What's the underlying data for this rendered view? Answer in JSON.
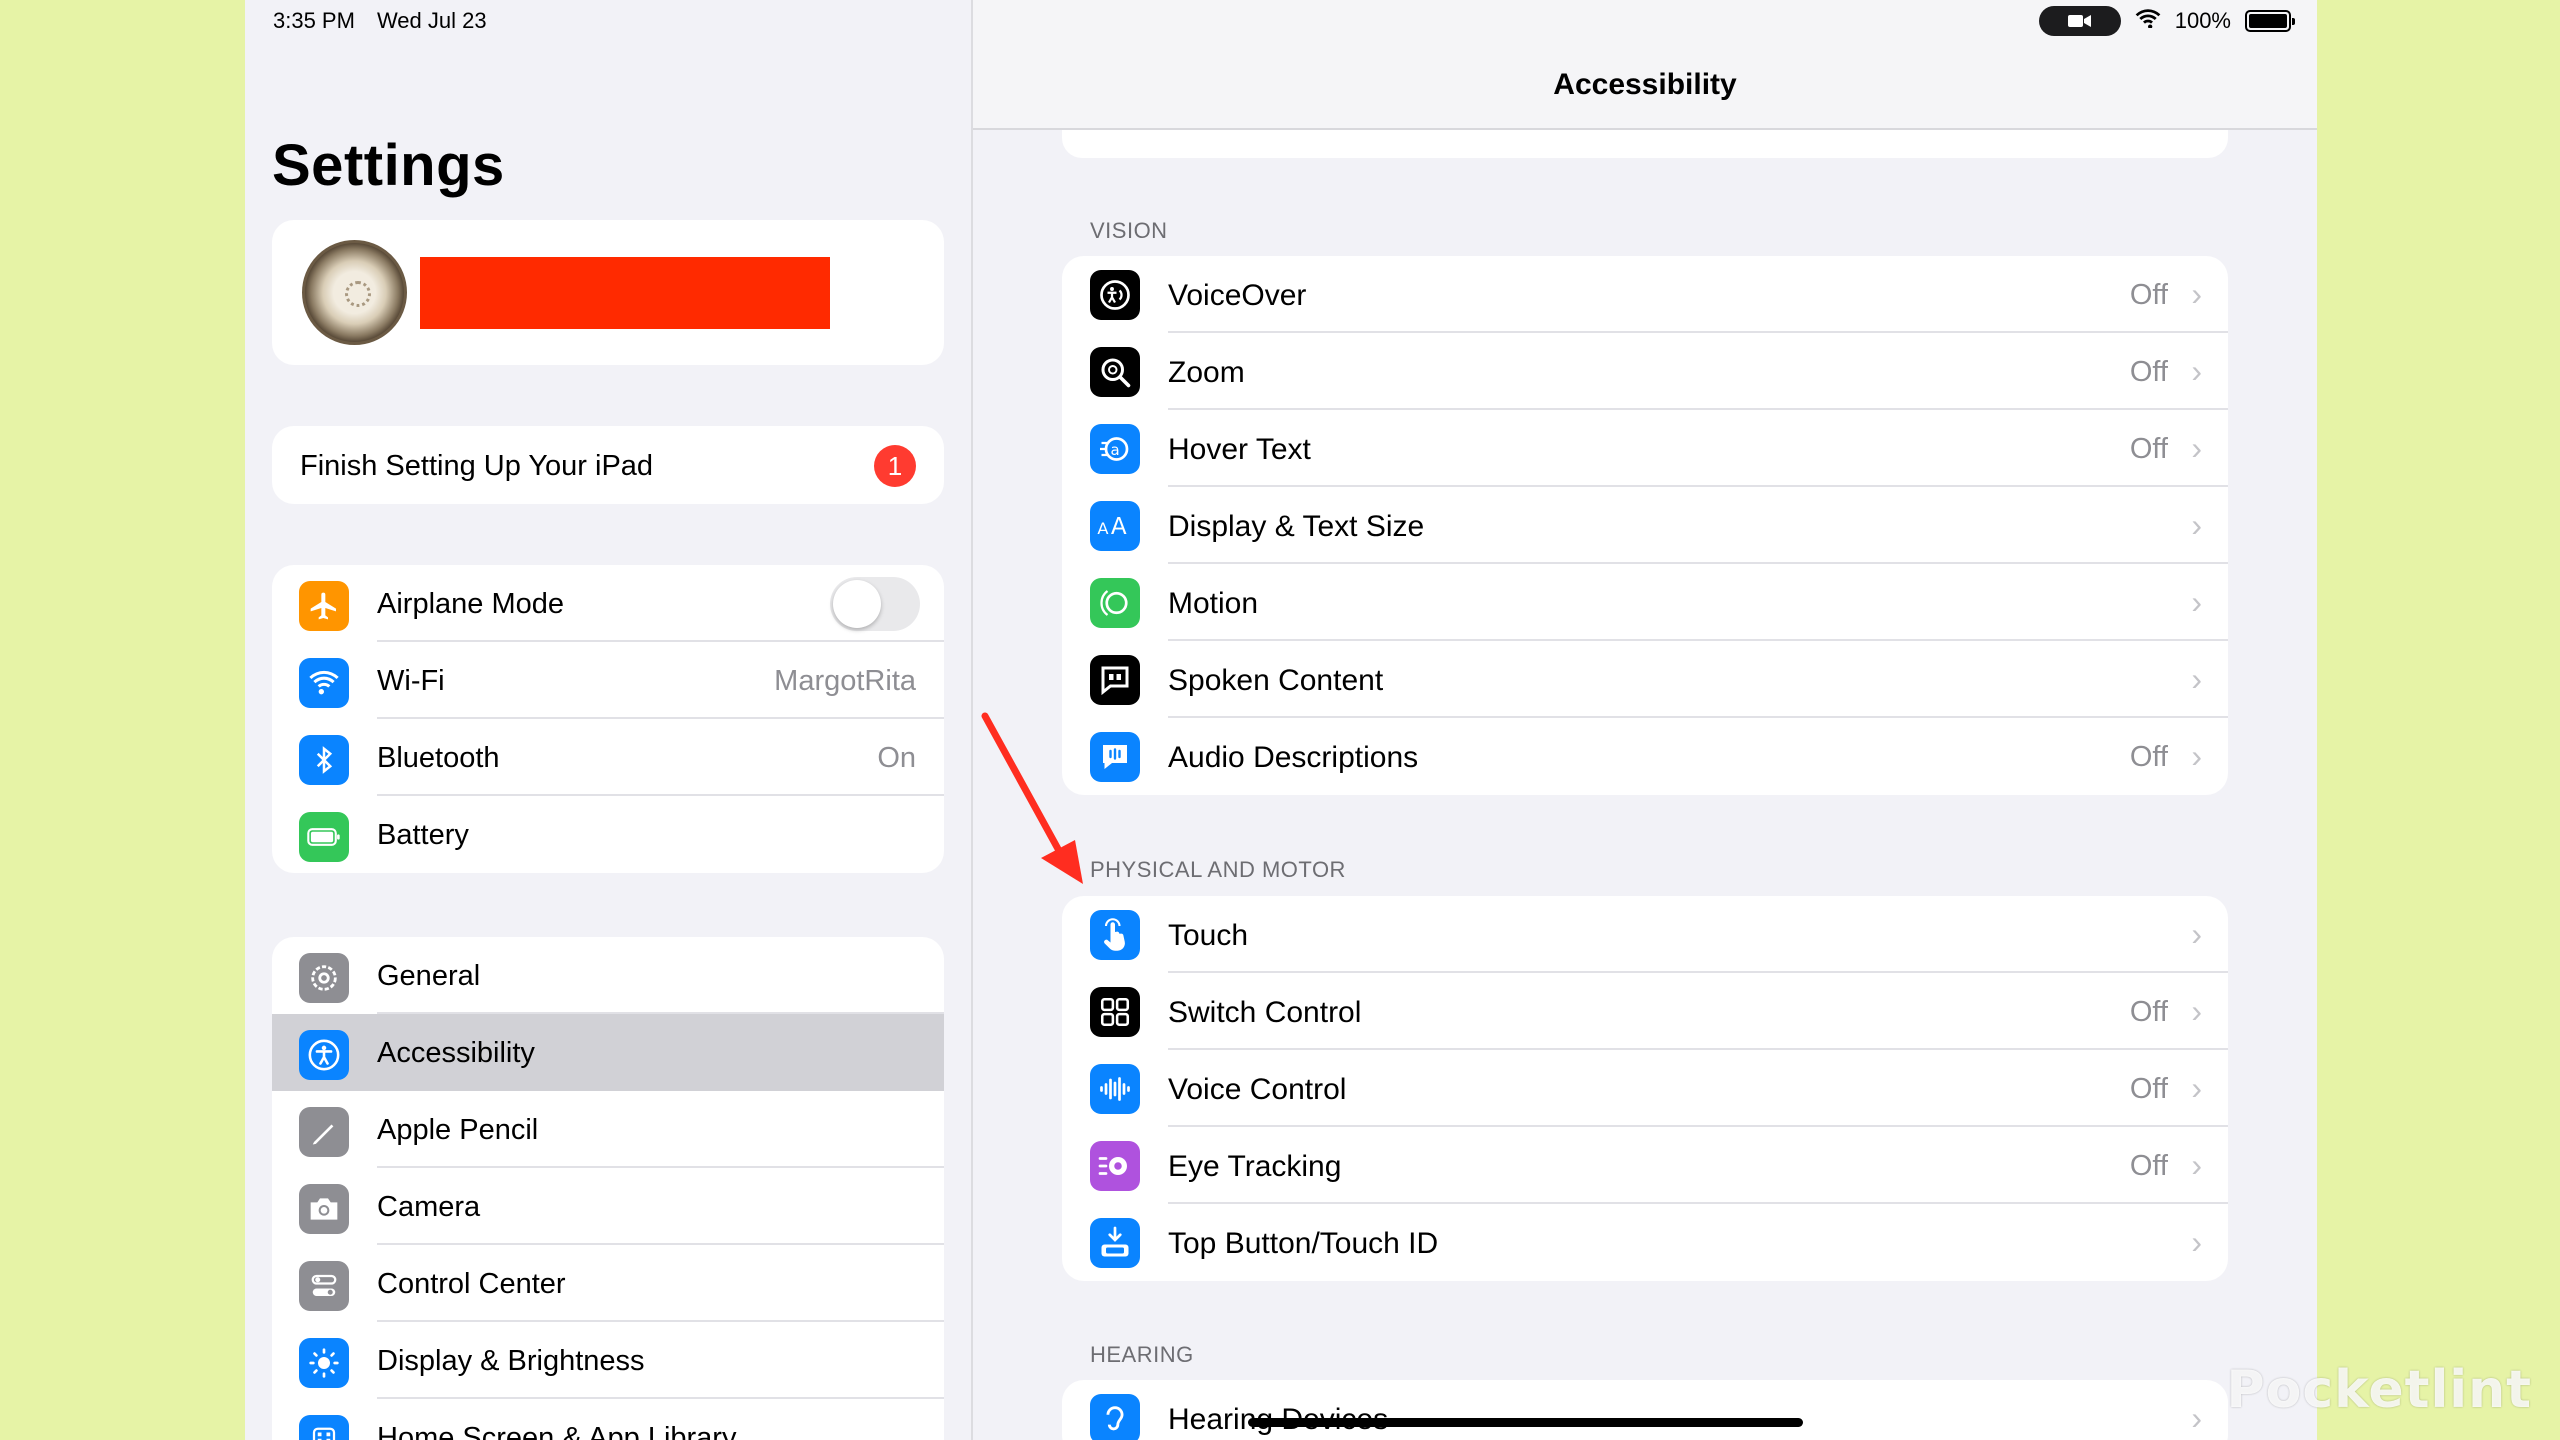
{
  "status_bar": {
    "time": "3:35 PM",
    "date": "Wed Jul 23",
    "battery": "100%"
  },
  "sidebar": {
    "title": "Settings",
    "finish_setup": {
      "label": "Finish Setting Up Your iPad",
      "badge": "1"
    },
    "connectivity": [
      {
        "label": "Airplane Mode",
        "icon": "airplane-icon",
        "color": "#ff9500",
        "toggle": false
      },
      {
        "label": "Wi-Fi",
        "icon": "wifi-icon",
        "color": "#0a84ff",
        "value": "MargotRita"
      },
      {
        "label": "Bluetooth",
        "icon": "bluetooth-icon",
        "color": "#0a84ff",
        "value": "On"
      },
      {
        "label": "Battery",
        "icon": "battery-icon",
        "color": "#34c759"
      }
    ],
    "general": [
      {
        "label": "General",
        "icon": "gear-icon",
        "color": "#8e8e93"
      },
      {
        "label": "Accessibility",
        "icon": "accessibility-icon",
        "color": "#0a84ff",
        "selected": true
      },
      {
        "label": "Apple Pencil",
        "icon": "pencil-icon",
        "color": "#8e8e93"
      },
      {
        "label": "Camera",
        "icon": "camera-icon",
        "color": "#8e8e93"
      },
      {
        "label": "Control Center",
        "icon": "control-center-icon",
        "color": "#8e8e93"
      },
      {
        "label": "Display & Brightness",
        "icon": "sun-icon",
        "color": "#0a84ff"
      },
      {
        "label": "Home Screen & App Library",
        "icon": "home-screen-icon",
        "color": "#0a84ff"
      }
    ]
  },
  "detail": {
    "title": "Accessibility",
    "vision": {
      "header": "VISION",
      "rows": [
        {
          "label": "VoiceOver",
          "value": "Off",
          "icon": "voiceover-icon",
          "color": "#000000"
        },
        {
          "label": "Zoom",
          "value": "Off",
          "icon": "zoom-icon",
          "color": "#000000"
        },
        {
          "label": "Hover Text",
          "value": "Off",
          "icon": "hover-text-icon",
          "color": "#0a84ff"
        },
        {
          "label": "Display & Text Size",
          "value": "",
          "icon": "text-size-icon",
          "color": "#0a84ff"
        },
        {
          "label": "Motion",
          "value": "",
          "icon": "motion-icon",
          "color": "#34c759"
        },
        {
          "label": "Spoken Content",
          "value": "",
          "icon": "spoken-content-icon",
          "color": "#000000"
        },
        {
          "label": "Audio Descriptions",
          "value": "Off",
          "icon": "audio-descriptions-icon",
          "color": "#0a84ff"
        }
      ]
    },
    "physical": {
      "header": "PHYSICAL AND MOTOR",
      "rows": [
        {
          "label": "Touch",
          "value": "",
          "icon": "touch-icon",
          "color": "#0a84ff"
        },
        {
          "label": "Switch Control",
          "value": "Off",
          "icon": "switch-control-icon",
          "color": "#000000"
        },
        {
          "label": "Voice Control",
          "value": "Off",
          "icon": "voice-control-icon",
          "color": "#0a84ff"
        },
        {
          "label": "Eye Tracking",
          "value": "Off",
          "icon": "eye-tracking-icon",
          "color": "#af52de"
        },
        {
          "label": "Top Button/Touch ID",
          "value": "",
          "icon": "top-button-icon",
          "color": "#0a84ff"
        }
      ]
    },
    "hearing": {
      "header": "HEARING",
      "rows": [
        {
          "label": "Hearing Devices",
          "value": "",
          "icon": "hearing-devices-icon",
          "color": "#0a84ff"
        }
      ]
    }
  },
  "watermark": "Pocketlint",
  "annotation": {
    "arrow_color": "#ff2d20"
  }
}
